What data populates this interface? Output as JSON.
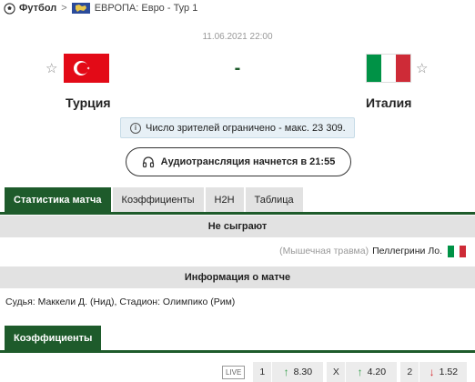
{
  "breadcrumb": {
    "sport": "Футбол",
    "separator": ">",
    "league": "ЕВРОПА: Евро - Тур 1",
    "sport_icon": "soccer-ball-icon",
    "region_icon": "europe-map-icon"
  },
  "match": {
    "datetime": "11.06.2021 22:00",
    "score": "-",
    "home": {
      "name": "Турция",
      "flag": "turkey-flag"
    },
    "away": {
      "name": "Италия",
      "flag": "italy-flag"
    }
  },
  "notice": {
    "icon": "info-icon",
    "text": "Число зрителей ограничено - макс. 23 309."
  },
  "audio": {
    "icon": "headphones-icon",
    "label": "Аудиотрансляция начнется в 21:55"
  },
  "tabs": [
    {
      "label": "Статистика матча",
      "active": true
    },
    {
      "label": "Коэффициенты",
      "active": false
    },
    {
      "label": "H2H",
      "active": false
    },
    {
      "label": "Таблица",
      "active": false
    }
  ],
  "missing": {
    "title": "Не сыграют",
    "players": [
      {
        "reason": "(Мышечная травма)",
        "name": "Пеллегрини Ло.",
        "flag": "italy-flag"
      }
    ]
  },
  "match_info": {
    "title": "Информация о матче",
    "details": "Судья: Маккели Д. (Нид), Стадион: Олимпико (Рим)"
  },
  "odds": {
    "tab_label": "Коэффициенты",
    "live_label": "LIVE",
    "items": [
      {
        "label": "1",
        "value": "8.30",
        "direction": "up"
      },
      {
        "label": "X",
        "value": "4.20",
        "direction": "up"
      },
      {
        "label": "2",
        "value": "1.52",
        "direction": "down"
      }
    ]
  },
  "colors": {
    "accent": "#1e5b2b",
    "up": "#2e9b45",
    "down": "#d8292f",
    "notice_bg": "#e7f0f6"
  }
}
